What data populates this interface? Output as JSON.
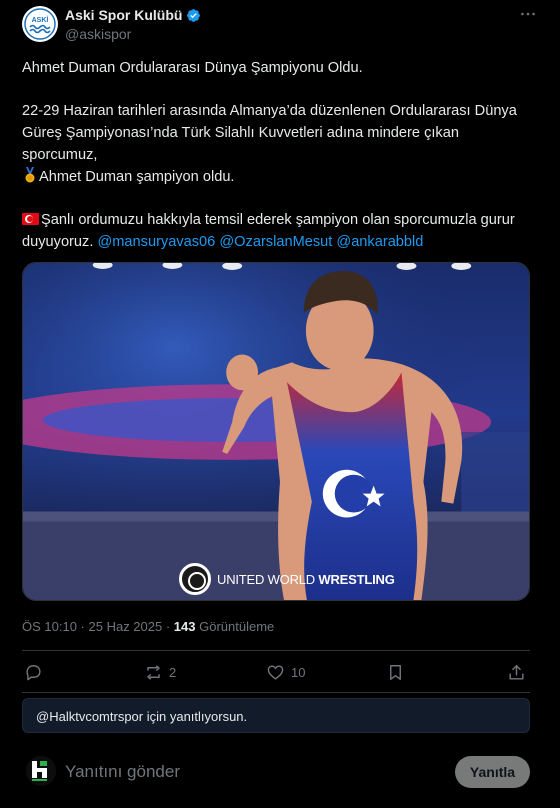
{
  "account": {
    "display_name": "Aski Spor Kulübü",
    "handle": "@askispor",
    "verified": true,
    "avatar_icon": "aski-logo-icon",
    "avatar_text": "ASKİ"
  },
  "tweet": {
    "headline": "Ahmet Duman Ordulararası Dünya Şampiyonu Oldu.",
    "paragraph_1": "22-29 Haziran tarihleri arasında Almanya’da düzenlenen Ordulararası Dünya Güreş Şampiyonası’nda Türk Silahlı Kuvvetleri adına mindere çıkan sporcumuz,",
    "paragraph_2": "Ahmet Duman şampiyon oldu.",
    "paragraph_2_icon": "gold-medal-icon",
    "paragraph_3": "Şanlı ordumuzu hakkıyla temsil ederek şampiyon olan sporcumuzla gurur duyuyoruz.",
    "paragraph_3_icon": "turkish-flag-icon",
    "mentions": [
      "@mansuryavas06",
      "@OzarslanMesut",
      "@ankarabbld"
    ]
  },
  "media": {
    "watermark_plain": "UNITED WORLD ",
    "watermark_bold": "WRESTLING",
    "watermark_icon": "uww-logo-icon"
  },
  "meta": {
    "time": "ÖS 10:10",
    "separator": " · ",
    "date": "25 Haz 2025",
    "views_count": "143",
    "views_label": " Görüntüleme"
  },
  "actions": {
    "reply_count": "",
    "retweet_count": "2",
    "like_count": "10"
  },
  "reply_banner": {
    "text": "@Halktvcomtrspor için yanıtlıyorsun."
  },
  "composer": {
    "placeholder": "Yanıtını gönder",
    "button_label": "Yanıtla",
    "avatar_icon": "halk-tv-logo-icon"
  },
  "colors": {
    "background": "#000000",
    "text": "#e7e9ea",
    "muted": "#71767b",
    "link": "#1d9bf0",
    "border": "#2f3336",
    "reply_button": "#787a7a"
  }
}
